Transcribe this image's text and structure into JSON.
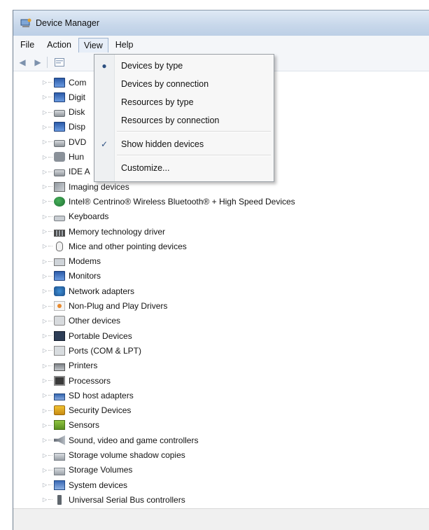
{
  "window": {
    "title": "Device Manager"
  },
  "menubar": {
    "items": [
      "File",
      "Action",
      "View",
      "Help"
    ],
    "active": "View"
  },
  "toolbar": {
    "buttons": [
      "back-icon",
      "forward-icon",
      "properties-icon"
    ]
  },
  "view_menu": {
    "items": [
      {
        "label": "Devices by type",
        "mark": "●"
      },
      {
        "label": "Devices by connection",
        "mark": ""
      },
      {
        "label": "Resources by type",
        "mark": ""
      },
      {
        "label": "Resources by connection",
        "mark": ""
      },
      {
        "label": "Show hidden devices",
        "mark": "✓"
      },
      {
        "label": "Customize...",
        "mark": ""
      }
    ]
  },
  "tree": {
    "items": [
      {
        "label": "Com",
        "icon": "computer-icon"
      },
      {
        "label": "Digit",
        "icon": "digitizer-icon"
      },
      {
        "label": "Disk",
        "icon": "disk-drive-icon"
      },
      {
        "label": "Disp",
        "icon": "display-adapter-icon"
      },
      {
        "label": "DVD",
        "icon": "dvd-drive-icon"
      },
      {
        "label": "Hun",
        "icon": "hid-icon"
      },
      {
        "label": "IDE A",
        "icon": "ide-controller-icon"
      },
      {
        "label": "Imaging devices",
        "icon": "imaging-device-icon"
      },
      {
        "label": "Intel® Centrino® Wireless Bluetooth® + High Speed Devices",
        "icon": "bluetooth-device-icon"
      },
      {
        "label": "Keyboards",
        "icon": "keyboard-icon"
      },
      {
        "label": "Memory technology driver",
        "icon": "memory-icon"
      },
      {
        "label": "Mice and other pointing devices",
        "icon": "mouse-icon"
      },
      {
        "label": "Modems",
        "icon": "modem-icon"
      },
      {
        "label": "Monitors",
        "icon": "monitor-icon"
      },
      {
        "label": "Network adapters",
        "icon": "network-adapter-icon"
      },
      {
        "label": "Non-Plug and Play Drivers",
        "icon": "non-pnp-driver-icon"
      },
      {
        "label": "Other devices",
        "icon": "other-device-icon"
      },
      {
        "label": "Portable Devices",
        "icon": "portable-device-icon"
      },
      {
        "label": "Ports (COM & LPT)",
        "icon": "port-icon"
      },
      {
        "label": "Printers",
        "icon": "printer-icon"
      },
      {
        "label": "Processors",
        "icon": "processor-icon"
      },
      {
        "label": "SD host adapters",
        "icon": "sd-host-adapter-icon"
      },
      {
        "label": "Security Devices",
        "icon": "security-device-icon"
      },
      {
        "label": "Sensors",
        "icon": "sensor-icon"
      },
      {
        "label": "Sound, video and game controllers",
        "icon": "sound-icon"
      },
      {
        "label": "Storage volume shadow copies",
        "icon": "shadow-copy-icon"
      },
      {
        "label": "Storage Volumes",
        "icon": "storage-volume-icon"
      },
      {
        "label": "System devices",
        "icon": "system-device-icon"
      },
      {
        "label": "Universal Serial Bus controllers",
        "icon": "usb-controller-icon"
      }
    ]
  }
}
